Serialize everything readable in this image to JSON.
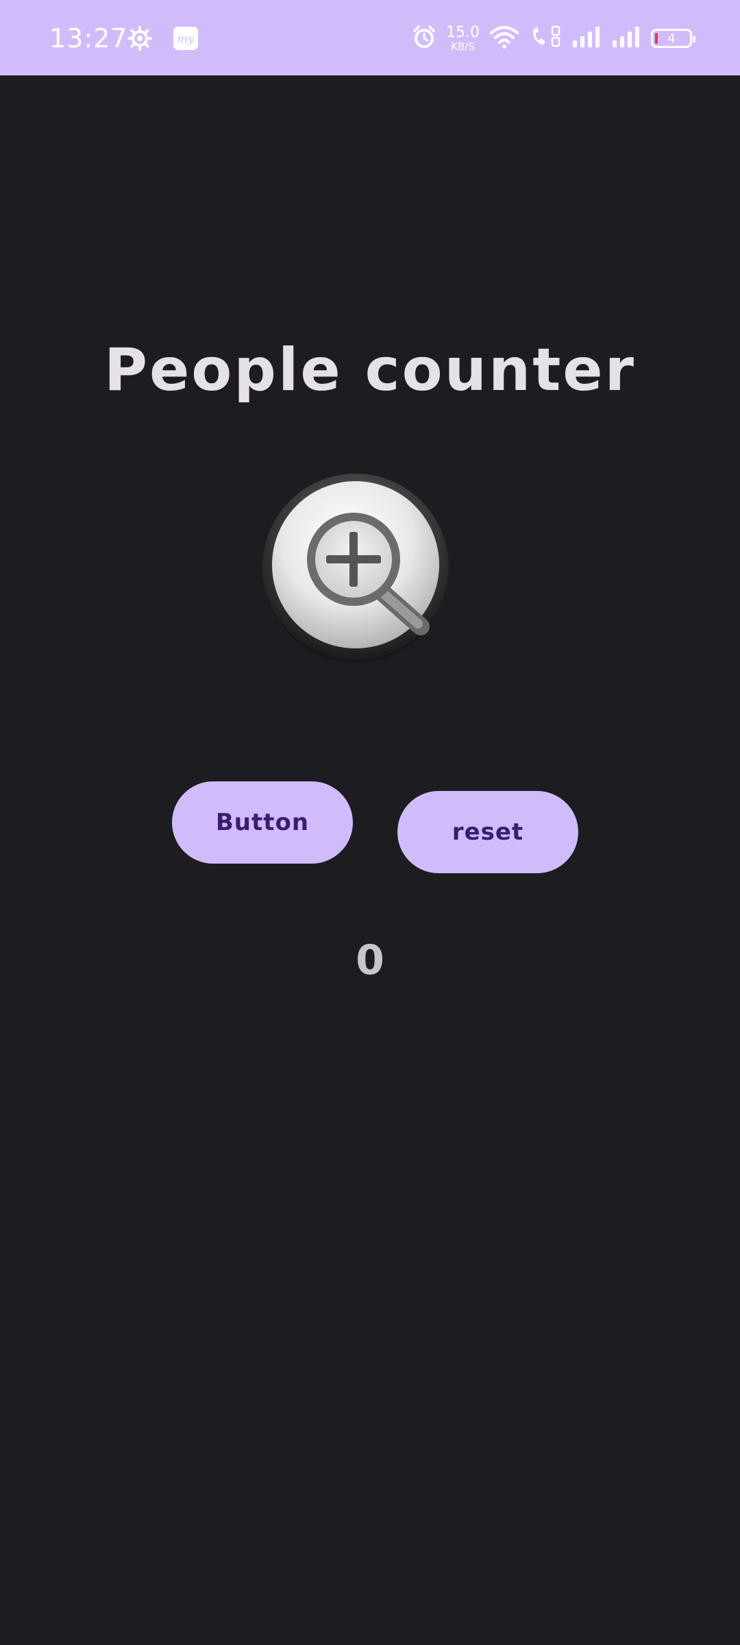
{
  "status_bar": {
    "time": "13:27",
    "net_speed_value": "15.0",
    "net_speed_unit": "KB/S",
    "battery_level": "4",
    "icons": [
      "settings-gear-icon",
      "my-app-icon",
      "alarm-icon",
      "wifi-icon",
      "volte-call-icon",
      "signal-1-icon",
      "signal-2-icon",
      "battery-icon"
    ]
  },
  "app": {
    "title": "People counter",
    "zoom_button_icon": "zoom-in-magnifier-icon",
    "button_label": "Button",
    "reset_label": "reset",
    "count": "0"
  },
  "colors": {
    "accent": "#d1bcfb",
    "background": "#1d1c21",
    "button_text": "#381e72",
    "title_text": "#e6e0e9",
    "counter_text": "#cac4d0"
  }
}
